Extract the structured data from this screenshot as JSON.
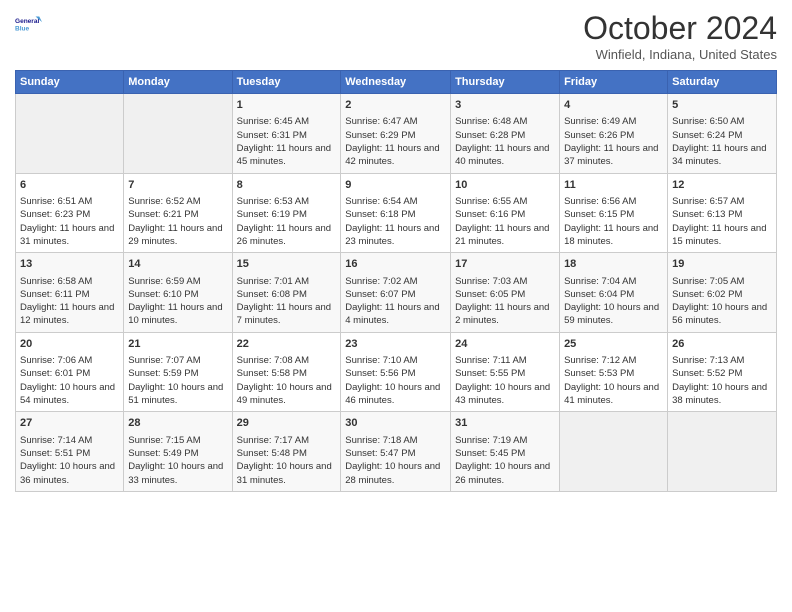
{
  "header": {
    "logo_line1": "General",
    "logo_line2": "Blue",
    "title": "October 2024",
    "subtitle": "Winfield, Indiana, United States"
  },
  "days_of_week": [
    "Sunday",
    "Monday",
    "Tuesday",
    "Wednesday",
    "Thursday",
    "Friday",
    "Saturday"
  ],
  "weeks": [
    [
      {
        "day": "",
        "data": ""
      },
      {
        "day": "",
        "data": ""
      },
      {
        "day": "1",
        "data": "Sunrise: 6:45 AM\nSunset: 6:31 PM\nDaylight: 11 hours and 45 minutes."
      },
      {
        "day": "2",
        "data": "Sunrise: 6:47 AM\nSunset: 6:29 PM\nDaylight: 11 hours and 42 minutes."
      },
      {
        "day": "3",
        "data": "Sunrise: 6:48 AM\nSunset: 6:28 PM\nDaylight: 11 hours and 40 minutes."
      },
      {
        "day": "4",
        "data": "Sunrise: 6:49 AM\nSunset: 6:26 PM\nDaylight: 11 hours and 37 minutes."
      },
      {
        "day": "5",
        "data": "Sunrise: 6:50 AM\nSunset: 6:24 PM\nDaylight: 11 hours and 34 minutes."
      }
    ],
    [
      {
        "day": "6",
        "data": "Sunrise: 6:51 AM\nSunset: 6:23 PM\nDaylight: 11 hours and 31 minutes."
      },
      {
        "day": "7",
        "data": "Sunrise: 6:52 AM\nSunset: 6:21 PM\nDaylight: 11 hours and 29 minutes."
      },
      {
        "day": "8",
        "data": "Sunrise: 6:53 AM\nSunset: 6:19 PM\nDaylight: 11 hours and 26 minutes."
      },
      {
        "day": "9",
        "data": "Sunrise: 6:54 AM\nSunset: 6:18 PM\nDaylight: 11 hours and 23 minutes."
      },
      {
        "day": "10",
        "data": "Sunrise: 6:55 AM\nSunset: 6:16 PM\nDaylight: 11 hours and 21 minutes."
      },
      {
        "day": "11",
        "data": "Sunrise: 6:56 AM\nSunset: 6:15 PM\nDaylight: 11 hours and 18 minutes."
      },
      {
        "day": "12",
        "data": "Sunrise: 6:57 AM\nSunset: 6:13 PM\nDaylight: 11 hours and 15 minutes."
      }
    ],
    [
      {
        "day": "13",
        "data": "Sunrise: 6:58 AM\nSunset: 6:11 PM\nDaylight: 11 hours and 12 minutes."
      },
      {
        "day": "14",
        "data": "Sunrise: 6:59 AM\nSunset: 6:10 PM\nDaylight: 11 hours and 10 minutes."
      },
      {
        "day": "15",
        "data": "Sunrise: 7:01 AM\nSunset: 6:08 PM\nDaylight: 11 hours and 7 minutes."
      },
      {
        "day": "16",
        "data": "Sunrise: 7:02 AM\nSunset: 6:07 PM\nDaylight: 11 hours and 4 minutes."
      },
      {
        "day": "17",
        "data": "Sunrise: 7:03 AM\nSunset: 6:05 PM\nDaylight: 11 hours and 2 minutes."
      },
      {
        "day": "18",
        "data": "Sunrise: 7:04 AM\nSunset: 6:04 PM\nDaylight: 10 hours and 59 minutes."
      },
      {
        "day": "19",
        "data": "Sunrise: 7:05 AM\nSunset: 6:02 PM\nDaylight: 10 hours and 56 minutes."
      }
    ],
    [
      {
        "day": "20",
        "data": "Sunrise: 7:06 AM\nSunset: 6:01 PM\nDaylight: 10 hours and 54 minutes."
      },
      {
        "day": "21",
        "data": "Sunrise: 7:07 AM\nSunset: 5:59 PM\nDaylight: 10 hours and 51 minutes."
      },
      {
        "day": "22",
        "data": "Sunrise: 7:08 AM\nSunset: 5:58 PM\nDaylight: 10 hours and 49 minutes."
      },
      {
        "day": "23",
        "data": "Sunrise: 7:10 AM\nSunset: 5:56 PM\nDaylight: 10 hours and 46 minutes."
      },
      {
        "day": "24",
        "data": "Sunrise: 7:11 AM\nSunset: 5:55 PM\nDaylight: 10 hours and 43 minutes."
      },
      {
        "day": "25",
        "data": "Sunrise: 7:12 AM\nSunset: 5:53 PM\nDaylight: 10 hours and 41 minutes."
      },
      {
        "day": "26",
        "data": "Sunrise: 7:13 AM\nSunset: 5:52 PM\nDaylight: 10 hours and 38 minutes."
      }
    ],
    [
      {
        "day": "27",
        "data": "Sunrise: 7:14 AM\nSunset: 5:51 PM\nDaylight: 10 hours and 36 minutes."
      },
      {
        "day": "28",
        "data": "Sunrise: 7:15 AM\nSunset: 5:49 PM\nDaylight: 10 hours and 33 minutes."
      },
      {
        "day": "29",
        "data": "Sunrise: 7:17 AM\nSunset: 5:48 PM\nDaylight: 10 hours and 31 minutes."
      },
      {
        "day": "30",
        "data": "Sunrise: 7:18 AM\nSunset: 5:47 PM\nDaylight: 10 hours and 28 minutes."
      },
      {
        "day": "31",
        "data": "Sunrise: 7:19 AM\nSunset: 5:45 PM\nDaylight: 10 hours and 26 minutes."
      },
      {
        "day": "",
        "data": ""
      },
      {
        "day": "",
        "data": ""
      }
    ]
  ]
}
